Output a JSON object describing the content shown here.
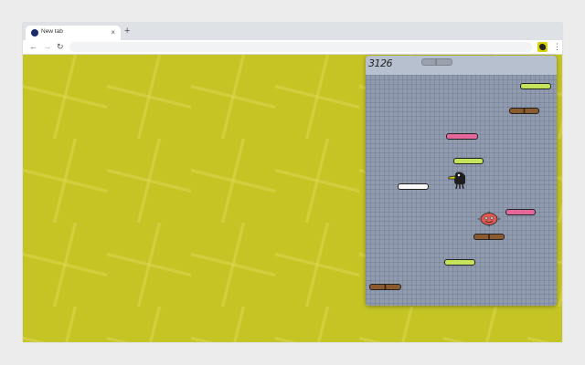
{
  "browser": {
    "tab": {
      "title": "New tab",
      "close_glyph": "×",
      "favicon": "favicon-icon"
    },
    "new_tab_glyph": "+",
    "toolbar": {
      "back_glyph": "←",
      "forward_glyph": "→",
      "reload_glyph": "↻",
      "address_value": "",
      "menu_glyph": "⋮",
      "extension_icon": "doodle-jump-extension-icon"
    }
  },
  "page": {
    "background_color": "#c5c425"
  },
  "game": {
    "score": "3126",
    "pause_button": "pause-icon",
    "platforms": [
      {
        "type": "green"
      },
      {
        "type": "brown"
      },
      {
        "type": "pink"
      },
      {
        "type": "green"
      },
      {
        "type": "white"
      },
      {
        "type": "pink"
      },
      {
        "type": "brown"
      },
      {
        "type": "green"
      },
      {
        "type": "brown"
      }
    ],
    "colors": {
      "green_platform": "#c6e45b",
      "pink_platform": "#e6679c",
      "brown_platform": "#8c5a2f",
      "white_platform": "#fafafa",
      "monster": "#e0584f",
      "doodler": "#1e1e1e"
    }
  }
}
